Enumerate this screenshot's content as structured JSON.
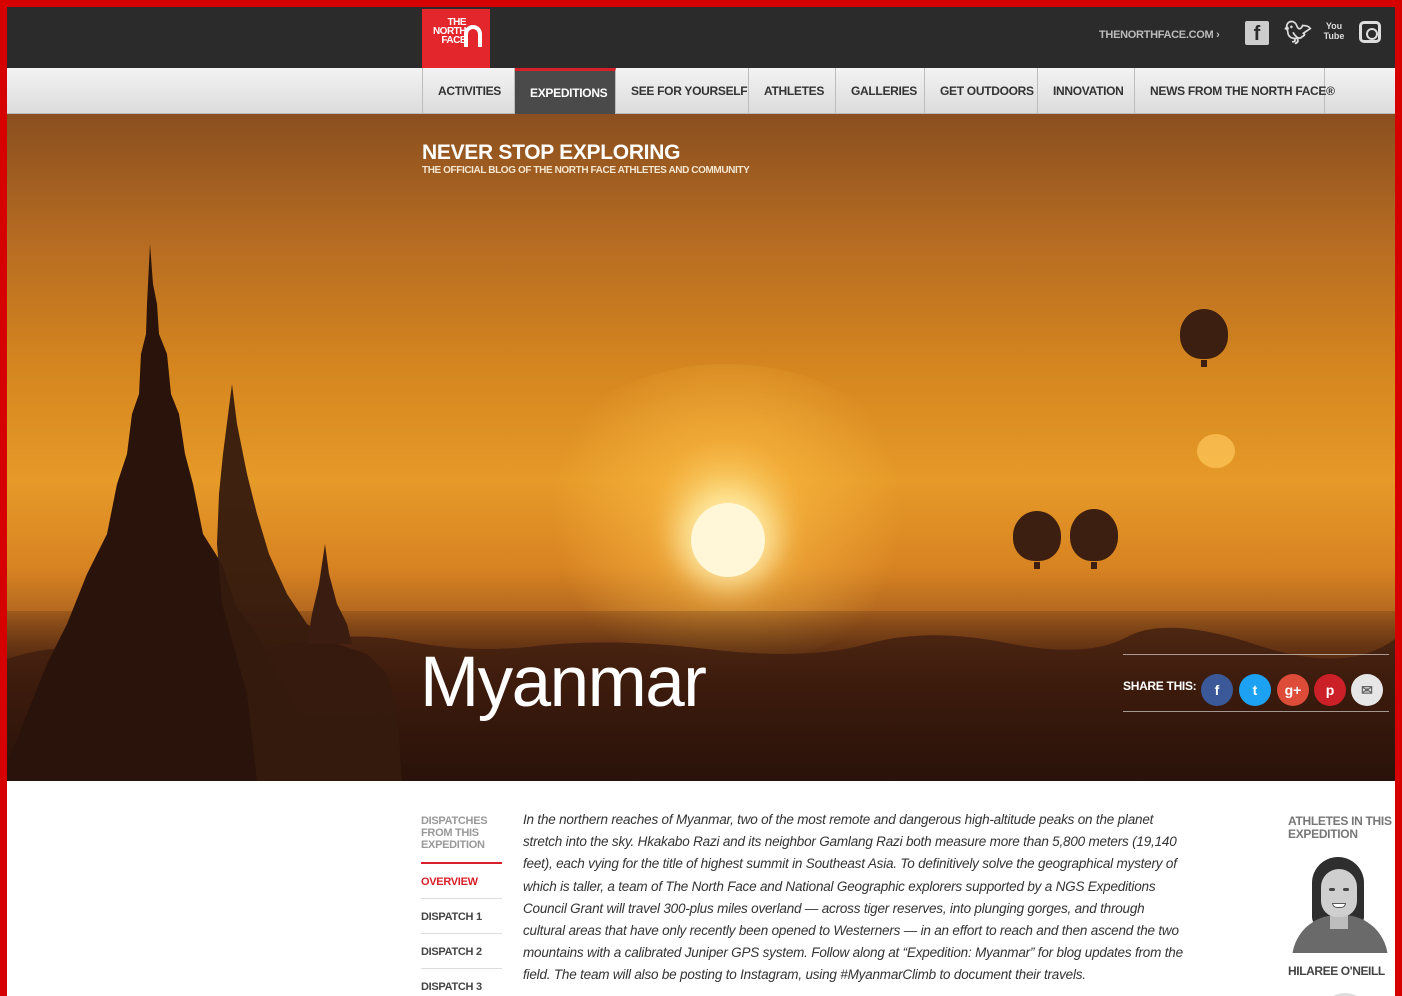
{
  "header": {
    "logo_text": "THE NORTH FACE",
    "site_link": "THENORTHFACE.COM",
    "social": [
      "facebook-icon",
      "twitter-icon",
      "youtube-icon",
      "instagram-icon"
    ],
    "youtube_label": "You Tube"
  },
  "nav": {
    "items": [
      {
        "label": "ACTIVITIES",
        "active": false
      },
      {
        "label": "EXPEDITIONS",
        "active": true
      },
      {
        "label": "SEE FOR YOURSELF",
        "active": false
      },
      {
        "label": "ATHLETES",
        "active": false
      },
      {
        "label": "GALLERIES",
        "active": false
      },
      {
        "label": "GET OUTDOORS",
        "active": false
      },
      {
        "label": "INNOVATION",
        "active": false
      },
      {
        "label": "NEWS FROM THE NORTH FACE®",
        "active": false
      }
    ]
  },
  "hero": {
    "blog_title": "NEVER STOP EXPLORING",
    "blog_subtitle": "THE OFFICIAL BLOG OF THE NORTH FACE ATHLETES AND COMMUNITY",
    "page_title": "Myanmar",
    "share_label": "SHARE THIS:",
    "share_icons": {
      "facebook": "f",
      "twitter": "t",
      "googleplus": "g+",
      "pinterest": "p",
      "email": "✉"
    }
  },
  "dispatches": {
    "heading": "DISPATCHES FROM THIS EXPEDITION",
    "items": [
      "OVERVIEW",
      "DISPATCH 1",
      "DISPATCH 2",
      "DISPATCH 3"
    ]
  },
  "body_text": "In the northern reaches of Myanmar, two of the most remote and dangerous high-altitude peaks on the planet stretch into the sky. Hkakabo Razi and its neighbor Gamlang Razi both measure more than 5,800 meters (19,140 feet), each vying for the title of highest summit in Southeast Asia. To definitively solve the geographical mystery of which is taller, a team of The North Face and National Geographic explorers supported by a NGS Expeditions Council Grant will travel 300-plus miles overland — across tiger reserves, into plunging gorges, and through cultural areas that have only recently been opened to Westerners — in an effort to reach and then ascend the two mountains with a calibrated Juniper GPS system. Follow along at “Expedition: Myanmar” for blog updates from the field. The team will also be posting to Instagram, using #MyanmarClimb to document their travels.",
  "athletes": {
    "heading": "ATHLETES IN THIS EXPEDITION",
    "names": [
      "HILAREE O'NEILL"
    ]
  },
  "colors": {
    "brand_red": "#d9202a",
    "topbar": "#2b2b2b",
    "nav_active": "#4a4a4a"
  }
}
